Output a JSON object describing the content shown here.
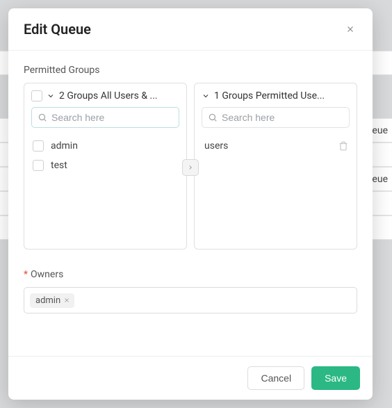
{
  "background": {
    "rowLabel2": "ueue",
    "rowLabel4": "ueue"
  },
  "modal": {
    "title": "Edit Queue",
    "permittedGroupsLabel": "Permitted Groups",
    "left": {
      "header": "2 Groups All Users & ...",
      "searchPlaceholder": "Search here",
      "items": [
        "admin",
        "test"
      ]
    },
    "right": {
      "header": "1 Groups Permitted Use...",
      "searchPlaceholder": "Search here",
      "items": [
        "users"
      ]
    },
    "owners": {
      "label": "Owners",
      "tags": [
        "admin"
      ]
    },
    "buttons": {
      "cancel": "Cancel",
      "save": "Save"
    }
  }
}
